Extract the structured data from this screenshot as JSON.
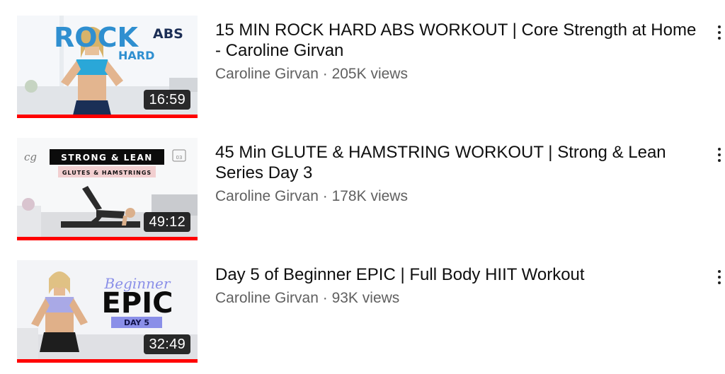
{
  "videos": [
    {
      "title": "15 MIN ROCK HARD ABS WORKOUT | Core Strength at Home - Caroline Girvan",
      "channel": "Caroline Girvan",
      "views": "205K views",
      "duration": "16:59",
      "watched_fraction": 1.0,
      "thumbnail": {
        "big_word": "ROCK",
        "side_word": "ABS",
        "sub_word": "HARD",
        "accent": "#2f8fd0"
      }
    },
    {
      "title": "45 Min GLUTE & HAMSTRING WORKOUT | Strong & Lean Series Day 3",
      "channel": "Caroline Girvan",
      "views": "178K views",
      "duration": "49:12",
      "watched_fraction": 1.0,
      "thumbnail": {
        "logo": "cg",
        "banner": "STRONG & LEAN",
        "sub_banner": "GLUTES & HAMSTRINGS",
        "badge": "03"
      }
    },
    {
      "title": "Day 5 of Beginner EPIC | Full Body HIIT Workout",
      "channel": "Caroline Girvan",
      "views": "93K views",
      "duration": "32:49",
      "watched_fraction": 1.0,
      "thumbnail": {
        "script_word": "Beginner",
        "big_word": "EPIC",
        "sub_word": "DAY 5",
        "accent": "#8a8fe8"
      }
    }
  ],
  "meta_separator": " · ",
  "colors": {
    "progress": "#ff0000",
    "meta_text": "#606060",
    "title_text": "#0f0f0f"
  },
  "icons": {
    "more": "vertical-ellipsis-icon"
  }
}
